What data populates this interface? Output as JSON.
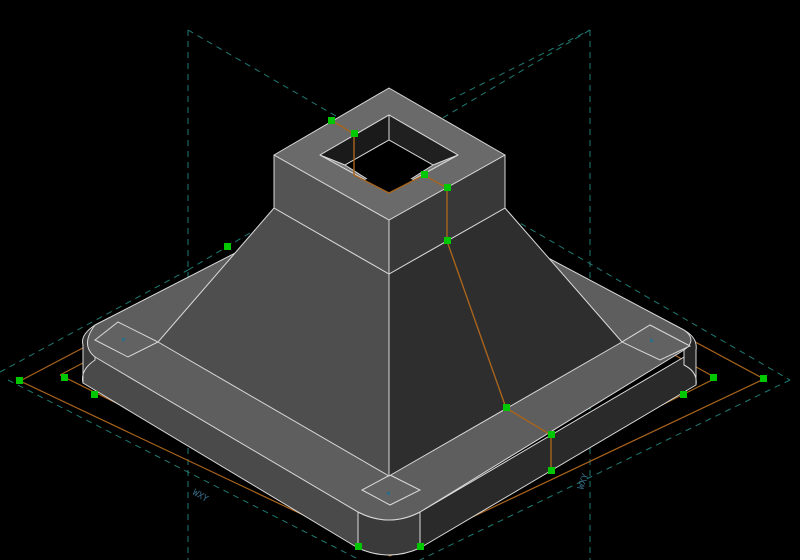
{
  "viewport": {
    "background": "#000000",
    "label_xy_1": "WXY",
    "label_xy_2": "WXY"
  },
  "colors": {
    "edge": "#d9d9d9",
    "face_top": "#6a6a6a",
    "face_left": "#4a4a4a",
    "face_right": "#303030",
    "face_dark": "#242424",
    "guide_dashed": "#1f7a72",
    "path_orange": "#a8641c",
    "grip_green": "#00c800"
  },
  "icons": {
    "grip": "square-grip-icon",
    "axis": "coordinate-axis-icon"
  }
}
